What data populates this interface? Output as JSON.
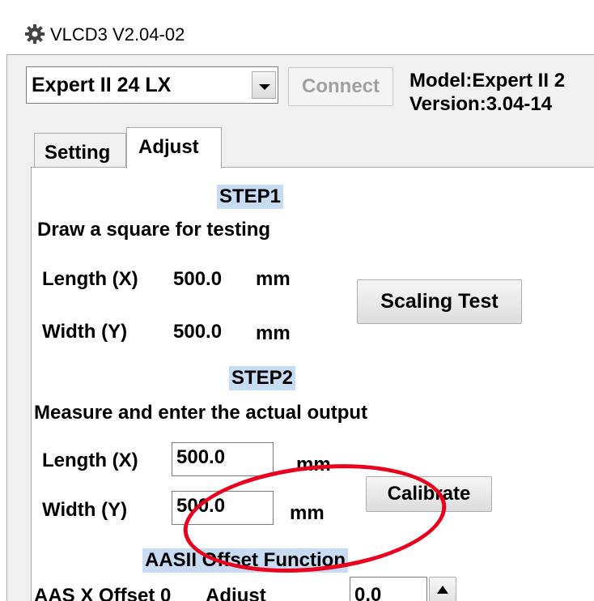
{
  "window": {
    "title": "VLCD3 V2.04-02",
    "app_icon": "gear-icon"
  },
  "toolbar": {
    "device_select_value": "Expert II 24 LX",
    "connect_label": "Connect",
    "model_text": "Model:Expert II 2",
    "version_text": "Version:3.04-14"
  },
  "tabs": [
    {
      "label": "Setting"
    },
    {
      "label": "Adjust"
    }
  ],
  "adjust": {
    "step1": {
      "heading": "STEP1",
      "instruction": "Draw a square for testing",
      "length_label": "Length (X)",
      "length_value": "500.0",
      "length_unit": "mm",
      "width_label": "Width (Y)",
      "width_value": "500.0",
      "width_unit": "mm",
      "button_label": "Scaling Test"
    },
    "step2": {
      "heading": "STEP2",
      "instruction": "Measure and enter the actual output",
      "length_label": "Length (X)",
      "length_value": "500.0",
      "length_unit": "mm",
      "width_label": "Width (Y)",
      "width_value": "500.0",
      "width_unit": "mm",
      "button_label": "Calibrate"
    },
    "offset": {
      "heading": "AASII Offset Function",
      "row_label": "AAS X Offset  0",
      "adjust_label": "Adjust",
      "adjust_value": "0.0"
    }
  },
  "annotation": {
    "color": "#e8001c"
  }
}
